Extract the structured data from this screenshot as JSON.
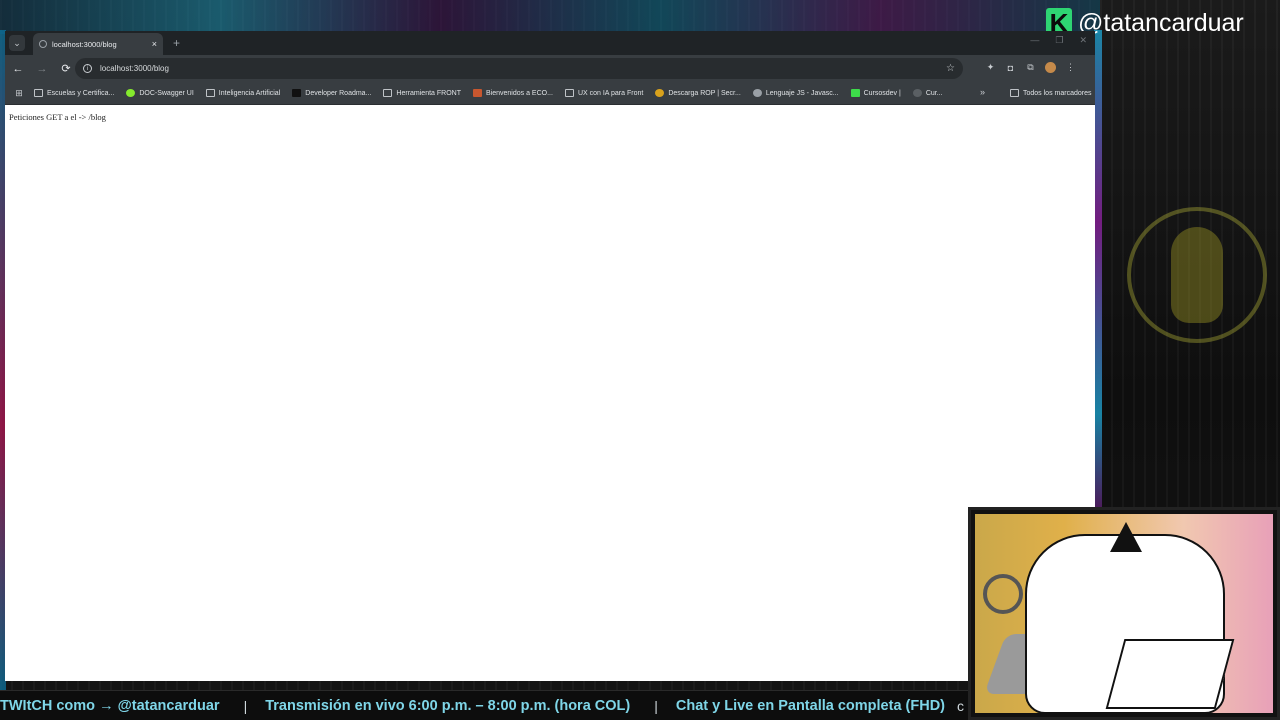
{
  "overlay": {
    "channel_name": "@tatancarduar",
    "logo_letter": "K",
    "accent": "#2ed573",
    "ticker": {
      "items": [
        "TWItCH como → @tatancarduar",
        "Transmisión en vivo  6:00 p.m. – 8:00 p.m. (hora COL)",
        "Chat y Live en Pantalla completa (FHD)"
      ],
      "separator": "|",
      "trailing": "c",
      "color": "#7fd6e8"
    }
  },
  "browser": {
    "tab": {
      "title": "localhost:3000/blog",
      "close": "×"
    },
    "new_tab": "+",
    "window_controls": [
      "—",
      "❐",
      "✕"
    ],
    "nav": {
      "back": "←",
      "forward": "→",
      "reload": "⟳"
    },
    "url": "localhost:3000/blog",
    "bookmarks": [
      {
        "label": "Escuelas y Certifica...",
        "icon": "folder-icon"
      },
      {
        "label": "DOC-Swagger UI",
        "icon": "swagger-icon"
      },
      {
        "label": "Inteligencia Artificial",
        "icon": "folder-icon"
      },
      {
        "label": "Developer Roadma...",
        "icon": "roadmap-icon"
      },
      {
        "label": "Herramienta FRONT",
        "icon": "folder-icon"
      },
      {
        "label": "Bienvenidos a ECO...",
        "icon": "eco-icon"
      },
      {
        "label": "UX con IA para Front",
        "icon": "folder-icon"
      },
      {
        "label": "Descarga ROP | Secr...",
        "icon": "rop-icon"
      },
      {
        "label": "Lenguaje JS - Javasc...",
        "icon": "js-icon"
      },
      {
        "label": "Cursosdev |",
        "icon": "cursosdev-icon"
      },
      {
        "label": "Cur...",
        "icon": "cur-icon"
      }
    ],
    "bookmarks_more": "»",
    "all_bookmarks": "Todos los marcadores",
    "page_text": "Peticiones GET a el -> /blog"
  }
}
